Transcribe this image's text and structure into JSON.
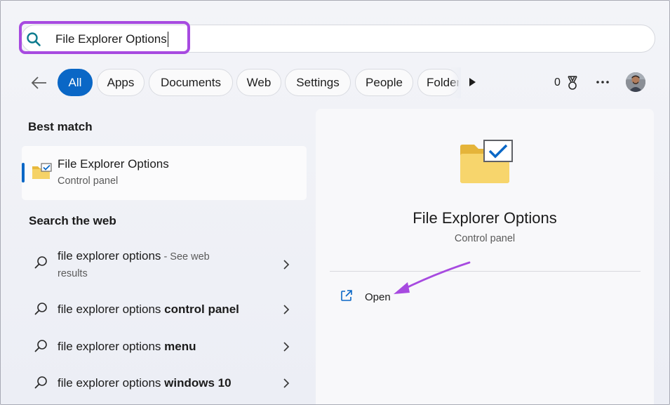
{
  "search": {
    "value": "File Explorer Options"
  },
  "filters": {
    "chips": [
      "All",
      "Apps",
      "Documents",
      "Web",
      "Settings",
      "People",
      "Folders"
    ],
    "active": "All",
    "rewards_count": "0"
  },
  "best_match": {
    "header": "Best match",
    "title": "File Explorer Options",
    "subtitle": "Control panel"
  },
  "web": {
    "header": "Search the web",
    "rows": [
      {
        "query": "file explorer options",
        "bold": "",
        "suffix": " - See web",
        "suffix2": "results"
      },
      {
        "query": "file explorer options ",
        "bold": "control panel"
      },
      {
        "query": "file explorer options ",
        "bold": "menu"
      },
      {
        "query": "file explorer options ",
        "bold": "windows 10"
      }
    ]
  },
  "preview": {
    "title": "File Explorer Options",
    "subtitle": "Control panel",
    "open_label": "Open"
  },
  "colors": {
    "accent": "#0a67c6",
    "highlight": "#a74ae0",
    "folder": "#f5d267"
  },
  "icons": {
    "search": "search-icon",
    "back": "arrow-left-icon",
    "more_filters": "play-icon",
    "rewards": "trophy-icon",
    "overflow": "ellipsis-icon",
    "folder": "folder-check-icon",
    "web_search": "search-icon",
    "chevron": "chevron-right-icon",
    "open": "open-external-icon"
  }
}
